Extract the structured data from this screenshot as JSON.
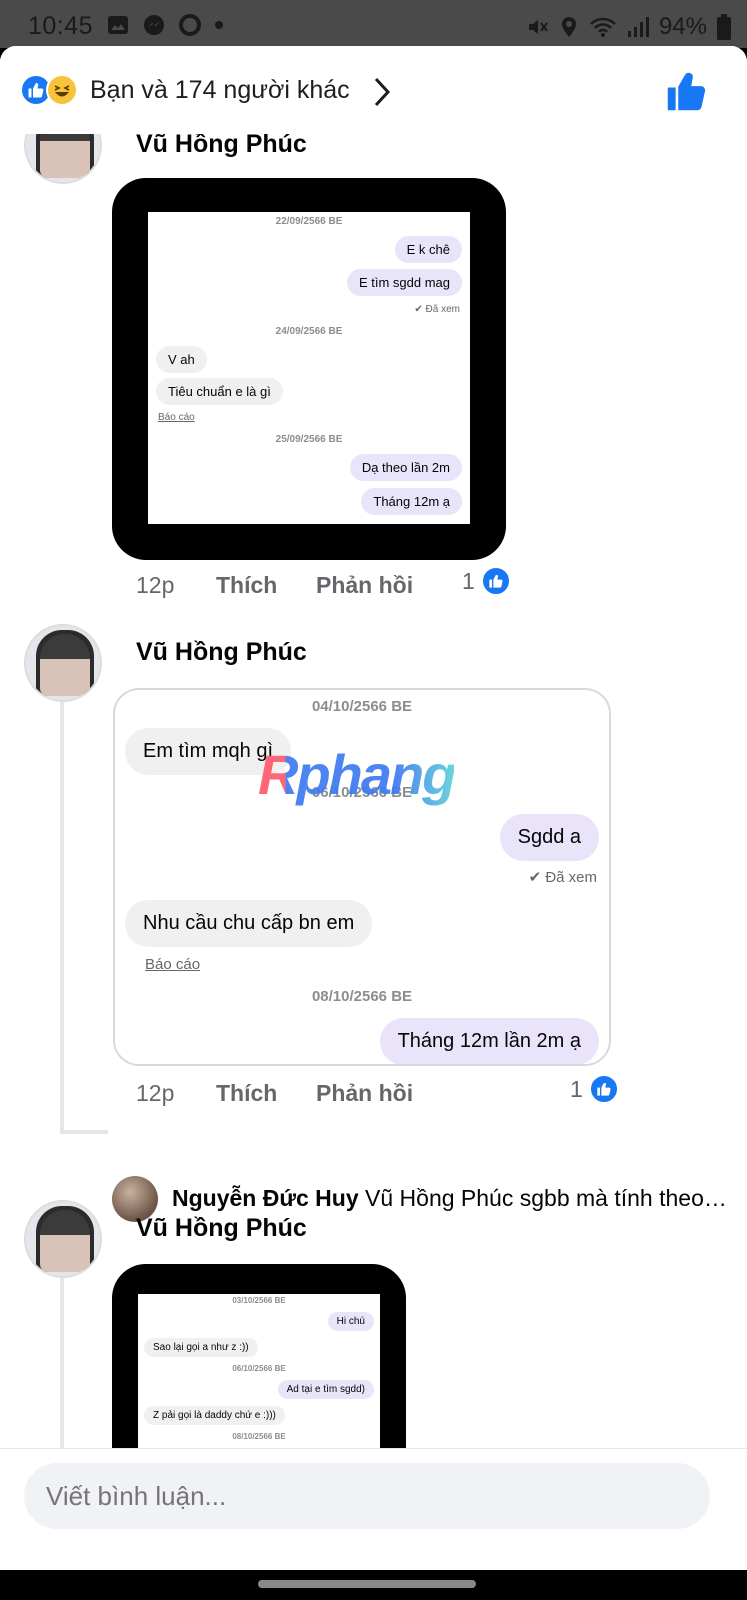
{
  "status_bar": {
    "time": "10:45",
    "battery": "94%"
  },
  "header": {
    "reactions_text": "Bạn và 174 người khác",
    "icons": [
      "like-icon",
      "haha-icon",
      "chevron-right-icon",
      "like-thumb-icon"
    ]
  },
  "comments": [
    {
      "author": "Vũ Hồng Phúc",
      "time": "12p",
      "like_label": "Thích",
      "reply_label": "Phản hồi",
      "likes": "1",
      "screenshot": {
        "messages": [
          {
            "type": "date",
            "text": "22/09/2566 BE"
          },
          {
            "type": "me",
            "text": "E k chê"
          },
          {
            "type": "me",
            "text": "E tìm sgdd mag"
          },
          {
            "type": "seen",
            "text": "Đã xem"
          },
          {
            "type": "date",
            "text": "24/09/2566 BE"
          },
          {
            "type": "them",
            "text": "V ah"
          },
          {
            "type": "them",
            "text": "Tiêu chuẩn e là gì"
          },
          {
            "type": "report",
            "text": "Báo cáo"
          },
          {
            "type": "date",
            "text": "25/09/2566 BE"
          },
          {
            "type": "me",
            "text": "Dạ theo lần 2m"
          },
          {
            "type": "me",
            "text": "Tháng 12m ạ"
          }
        ]
      }
    },
    {
      "author": "Vũ Hồng Phúc",
      "time": "12p",
      "like_label": "Thích",
      "reply_label": "Phản hồi",
      "likes": "1",
      "card": {
        "messages": [
          {
            "type": "date",
            "text": "04/10/2566 BE"
          },
          {
            "type": "them",
            "text": "Em tìm mqh gì"
          },
          {
            "type": "date",
            "text": "06/10/2566 BE"
          },
          {
            "type": "me",
            "text": "Sgdd a"
          },
          {
            "type": "seen",
            "text": "Đã xem"
          },
          {
            "type": "them",
            "text": "Nhu cầu chu cấp bn em"
          },
          {
            "type": "report",
            "text": "Báo cáo"
          },
          {
            "type": "date",
            "text": "08/10/2566 BE"
          },
          {
            "type": "me",
            "text": "Tháng 12m lần 2m ạ"
          }
        ]
      },
      "watermark": "Rphang",
      "reply": {
        "author": "Nguyễn Đức Huy",
        "text": "Vũ Hồng Phúc sgbb mà tính theo…"
      }
    },
    {
      "author": "Vũ Hồng Phúc",
      "screenshot": {
        "messages": [
          {
            "type": "date",
            "text": "03/10/2566 BE"
          },
          {
            "type": "me",
            "text": "Hi chú"
          },
          {
            "type": "them",
            "text": "Sao lại gọi a như z :))"
          },
          {
            "type": "date",
            "text": "06/10/2566 BE"
          },
          {
            "type": "me",
            "text": "Ad tại e tìm sgdd)"
          },
          {
            "type": "them",
            "text": "Z pải gọi là daddy chứ e :)))"
          },
          {
            "type": "date",
            "text": "08/10/2566 BE"
          }
        ]
      }
    }
  ],
  "composer": {
    "placeholder": "Viết bình luận..."
  },
  "colors": {
    "accent": "#1877f2",
    "bubble_me": "#e9e4fa",
    "bubble_them": "#f0f0f0"
  }
}
